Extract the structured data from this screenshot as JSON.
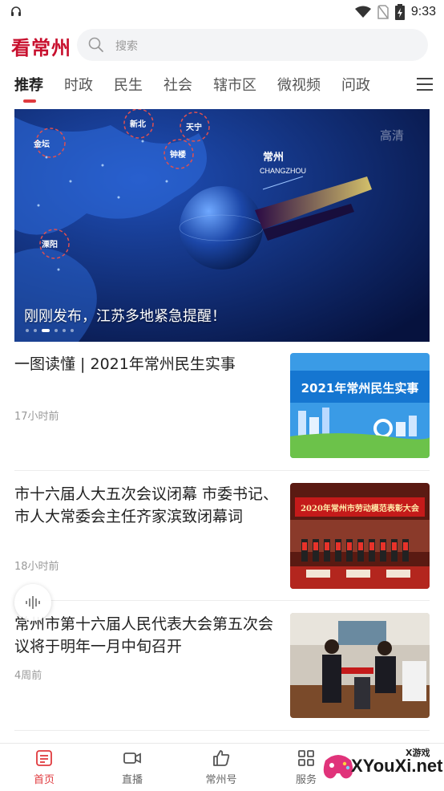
{
  "status_bar": {
    "time": "9:33"
  },
  "header": {
    "logo_text": "看常州",
    "search_placeholder": "搜索"
  },
  "tabs": [
    {
      "label": "推荐",
      "active": true
    },
    {
      "label": "时政"
    },
    {
      "label": "民生"
    },
    {
      "label": "社会"
    },
    {
      "label": "辖市区"
    },
    {
      "label": "微视频"
    },
    {
      "label": "问政"
    }
  ],
  "banner": {
    "caption": "刚刚发布，江苏多地紧急提醒！",
    "badge": "高清",
    "map_labels": [
      "常州",
      "CHANGZHOU",
      "金坛",
      "溧阳",
      "天宁",
      "钟楼",
      "新北"
    ],
    "slide_count": 6,
    "active_slide": 3
  },
  "news": [
    {
      "title": "一图读懂 | 2021年常州民生实事",
      "time": "17小时前",
      "thumb_text": "2021年常州民生实事"
    },
    {
      "title": "市十六届人大五次会议闭幕 市委书记、市人大常委会主任齐家滨致闭幕词",
      "time": "18小时前",
      "thumb_text": "2020年常州市劳动模范表彰大会"
    },
    {
      "title": "常州市第十六届人民代表大会第五次会议将于明年一月中旬召开",
      "time": "4周前"
    }
  ],
  "bottom_nav": [
    {
      "label": "首页",
      "icon": "news-icon",
      "active": true
    },
    {
      "label": "直播",
      "icon": "video-camera-icon"
    },
    {
      "label": "常州号",
      "icon": "thumbs-up-icon"
    },
    {
      "label": "服务",
      "icon": "grid-icon"
    }
  ],
  "watermark": {
    "text": "XYouXi.net",
    "small": "X游戏"
  },
  "colors": {
    "accent": "#e03a3e",
    "logo": "#c8102e"
  }
}
